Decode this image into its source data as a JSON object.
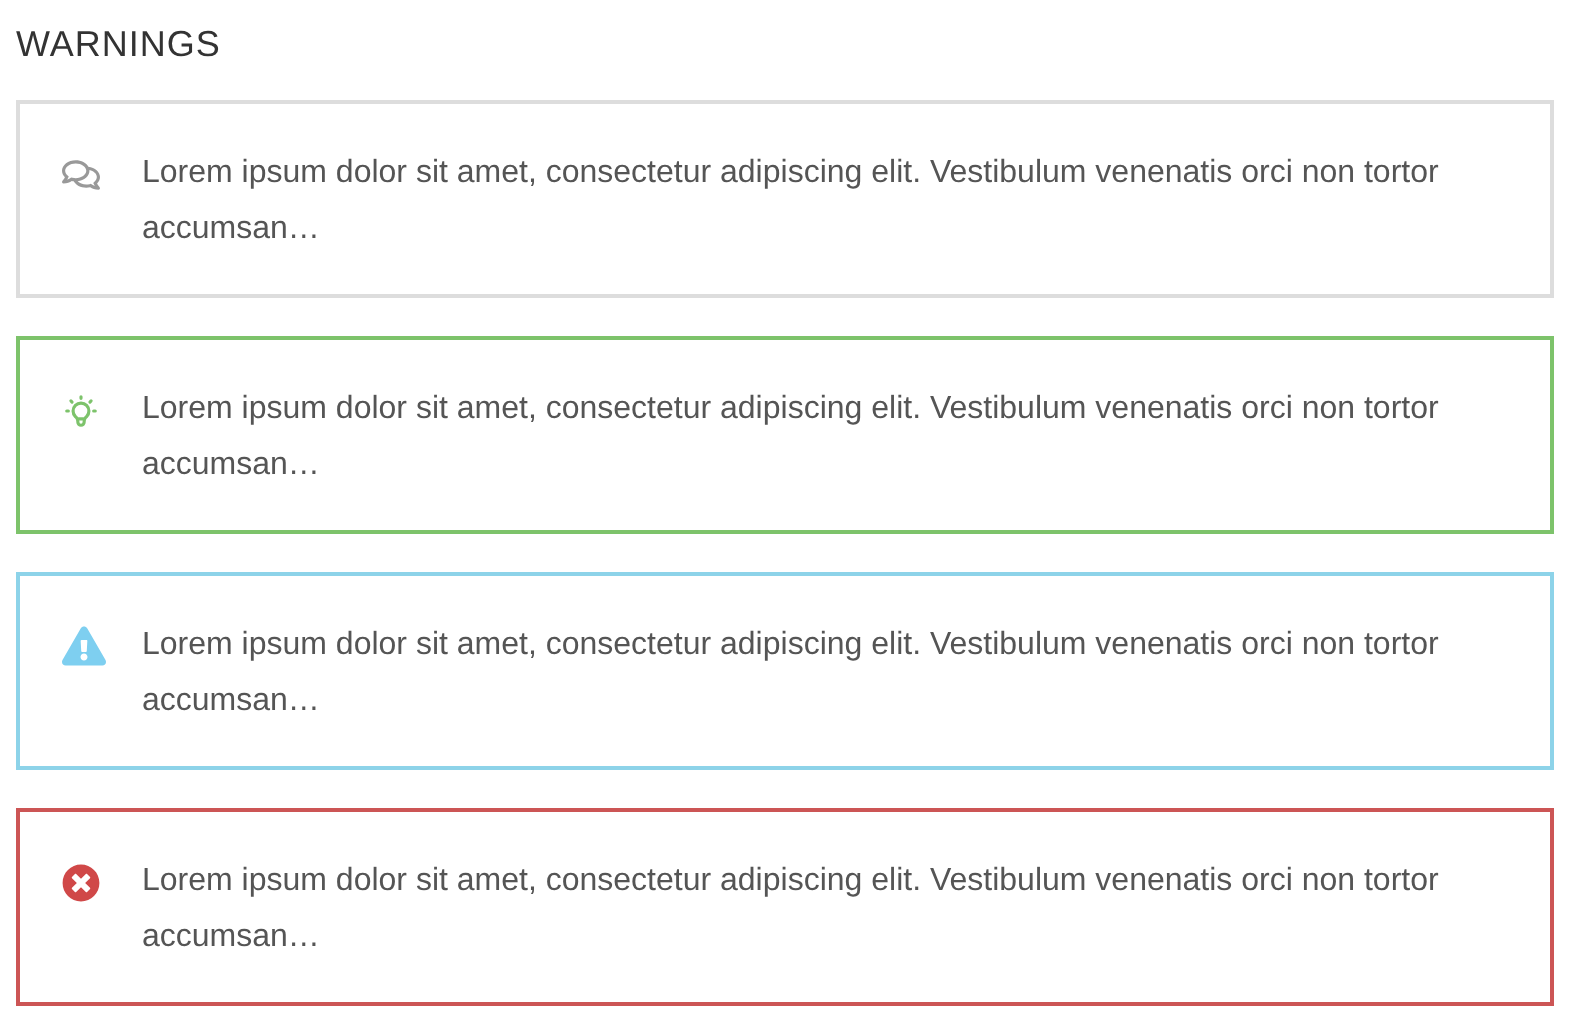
{
  "heading": "WARNINGS",
  "alerts": [
    {
      "kind": "note",
      "color": "#dddddd",
      "text": "Lorem ipsum dolor sit amet, consectetur adipiscing elit. Vestibulum venenatis orci non tortor accumsan…"
    },
    {
      "kind": "tip",
      "color": "#7dc36b",
      "text": "Lorem ipsum dolor sit amet, consectetur adipiscing elit. Vestibulum venenatis orci non tortor accumsan…"
    },
    {
      "kind": "info",
      "color": "#8dd3e9",
      "text": "Lorem ipsum dolor sit amet, consectetur adipiscing elit. Vestibulum venenatis orci non tortor accumsan…"
    },
    {
      "kind": "error",
      "color": "#cc5555",
      "text": "Lorem ipsum dolor sit amet, consectetur adipiscing elit. Vestibulum venenatis orci non tortor accumsan…"
    }
  ]
}
